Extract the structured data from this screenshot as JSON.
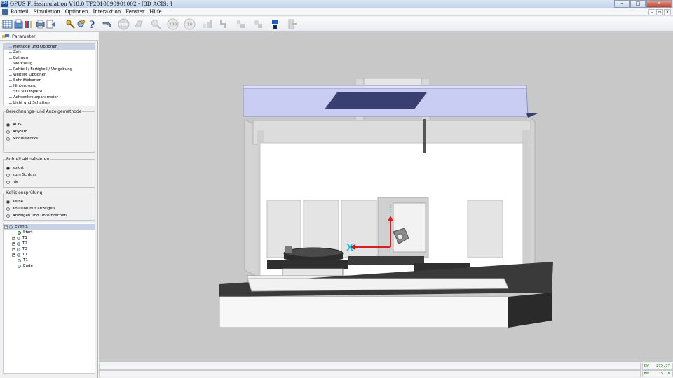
{
  "window": {
    "app_icon_text": "OM",
    "title": "OPUS Frässimulation V18.0  TP2010090901002    - [3D ACIS: ]",
    "btn_min": "–",
    "btn_max": "□",
    "btn_close": "✕"
  },
  "menu": {
    "items": [
      "Rohteil",
      "Simulation",
      "Optionen",
      "Interaktion",
      "Fenster",
      "Hilfe"
    ],
    "mdi_min": "–",
    "mdi_restore": "▫",
    "mdi_close": "x"
  },
  "toolbar": {
    "stop_label": "STOP",
    "speed_200": "200",
    "speed_10": "10"
  },
  "panel": {
    "title": "Parameter",
    "nav_items": [
      "Methode und Optionen",
      "Zeit",
      "Bahnen",
      "Werkzeug",
      "Rohteil / Fertigteil / Umgebung",
      "weitere Optionen",
      "Schnittebenen",
      "Hintergrund",
      "Stil 3D Objekte",
      "Achsenkreuzparameter",
      "Licht und Schatten"
    ],
    "calc_group": {
      "legend": "Berechnungs- und Anzeigemethode",
      "options": [
        "ACIS",
        "AnySim",
        "Moduleworks"
      ],
      "selected": 0
    },
    "update_group": {
      "legend": "Rohteil aktualisieren",
      "options": [
        "sofort",
        "zum Schluss",
        "nie"
      ],
      "selected": 0
    },
    "collision_group": {
      "legend": "Kollisionsprüfung",
      "options": [
        "Keine",
        "Kollision nur anzeigen",
        "Anzeigen und Unterbrechen"
      ],
      "selected": 0
    },
    "tree": {
      "root": "Events",
      "nodes": [
        {
          "label": "Start",
          "expandable": false,
          "active": true
        },
        {
          "label": "T1",
          "expandable": true,
          "active": false
        },
        {
          "label": "T2",
          "expandable": true,
          "active": false
        },
        {
          "label": "T3",
          "expandable": true,
          "active": false
        },
        {
          "label": "T1",
          "expandable": true,
          "active": false
        },
        {
          "label": "T1",
          "expandable": false,
          "active": false
        },
        {
          "label": "Ende",
          "expandable": false,
          "active": false
        }
      ]
    }
  },
  "viewport": {
    "axis_label": "X",
    "colors": {
      "background": "#c8c8c8",
      "axis_x": "#d42020",
      "axis_z": "#d42020",
      "axis_marker": "#19c6e0",
      "roof": "#c9cdf3",
      "roof_dark": "#3a3f72"
    }
  },
  "status": {
    "dw_label": "DW",
    "dw_value": "275.77",
    "kw_label": "KW",
    "kw_value": "5.10"
  }
}
